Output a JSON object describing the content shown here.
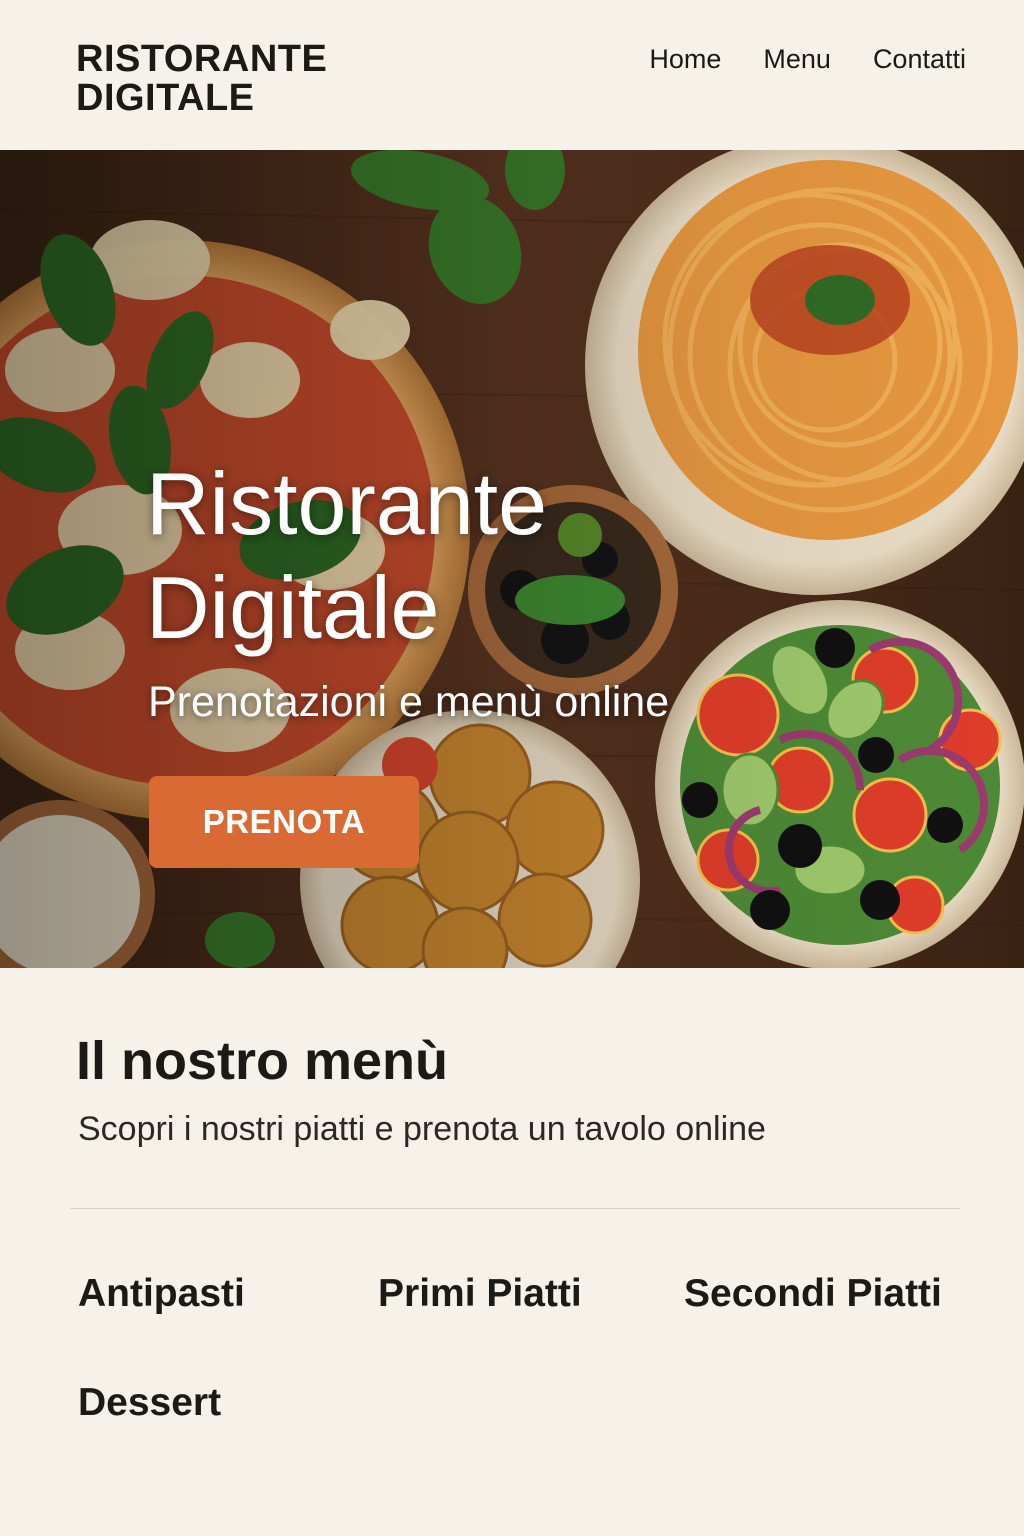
{
  "header": {
    "logo_line1": "RISTORANTE",
    "logo_line2": "DIGITALE",
    "nav": [
      {
        "label": "Home"
      },
      {
        "label": "Menu"
      },
      {
        "label": "Contatti"
      }
    ]
  },
  "hero": {
    "title_line1": "Ristorante",
    "title_line2": "Digitale",
    "subtitle": "Prenotazioni e menù online",
    "cta_label": "PRENOTA"
  },
  "menu_section": {
    "title": "Il nostro menù",
    "description": "Scopri i nostri piatti e prenota un tavolo online",
    "categories": [
      {
        "label": "Antipasti"
      },
      {
        "label": "Primi Piatti"
      },
      {
        "label": "Secondi Piatti"
      },
      {
        "label": "Dessert"
      }
    ]
  },
  "colors": {
    "background": "#f7f2e9",
    "accent": "#d96a33",
    "text": "#1c1a17",
    "hero_wood": "#4a2c1a"
  }
}
